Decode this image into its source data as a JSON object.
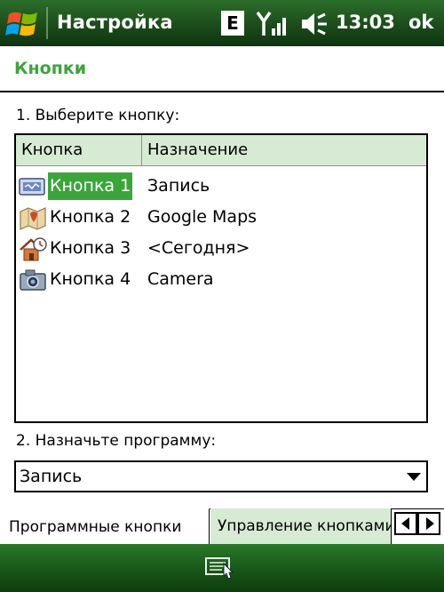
{
  "titlebar": {
    "title": "Настройка",
    "network": "E",
    "time": "13:03",
    "ok": "ok"
  },
  "page": {
    "heading": "Кнопки",
    "step1": "1. Выберите кнопку:",
    "step2": "2. Назначьте программу:"
  },
  "list": {
    "columns": [
      "Кнопка",
      "Назначение"
    ],
    "rows": [
      {
        "button": "Кнопка 1",
        "target": "Запись",
        "icon": "recorder-icon",
        "selected": true
      },
      {
        "button": "Кнопка 2",
        "target": "Google Maps",
        "icon": "map-icon",
        "selected": false
      },
      {
        "button": "Кнопка 3",
        "target": "<Сегодня>",
        "icon": "home-clock-icon",
        "selected": false
      },
      {
        "button": "Кнопка 4",
        "target": "Camera",
        "icon": "camera-icon",
        "selected": false
      }
    ]
  },
  "program_select": {
    "value": "Запись"
  },
  "tabs": [
    {
      "label": "Программные кнопки",
      "active": true
    },
    {
      "label": "Управление кнопками",
      "active": false
    }
  ],
  "colors": {
    "accent": "#3aa63a",
    "bar_dark": "#1d4f1d",
    "header_bg": "#d7ead4"
  }
}
